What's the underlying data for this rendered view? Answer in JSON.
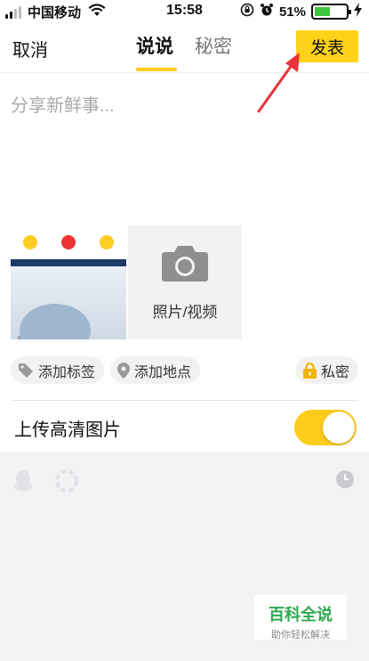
{
  "status": {
    "carrier": "中国移动",
    "time": "15:58",
    "battery_percent_label": "51%",
    "battery_level": 0.51
  },
  "nav": {
    "cancel_label": "取消",
    "tabs": [
      {
        "label": "说说",
        "active": true
      },
      {
        "label": "秘密",
        "active": false
      }
    ],
    "publish_label": "发表"
  },
  "compose": {
    "placeholder": "分享新鲜事..."
  },
  "media": {
    "add_label": "照片/视频"
  },
  "chips": {
    "tag_label": "添加标签",
    "location_label": "添加地点",
    "privacy_label": "私密"
  },
  "hd_upload": {
    "label": "上传高清图片",
    "enabled": true
  },
  "watermark": {
    "title": "百科全说",
    "subtitle": "助你轻松解决"
  },
  "colors": {
    "accent": "#ffcc1a",
    "publish_bg": "#ffd11a",
    "battery_fill": "#3ec73e",
    "placeholder_text": "#aaaaaa",
    "annotation_arrow": "#e8333a"
  },
  "icons": [
    "wifi-icon",
    "rotation-lock-icon",
    "alarm-icon",
    "charging-bolt-icon",
    "camera-icon",
    "tag-icon",
    "location-pin-icon",
    "lock-icon",
    "qq-icon",
    "wechat-moments-icon",
    "clock-icon"
  ]
}
